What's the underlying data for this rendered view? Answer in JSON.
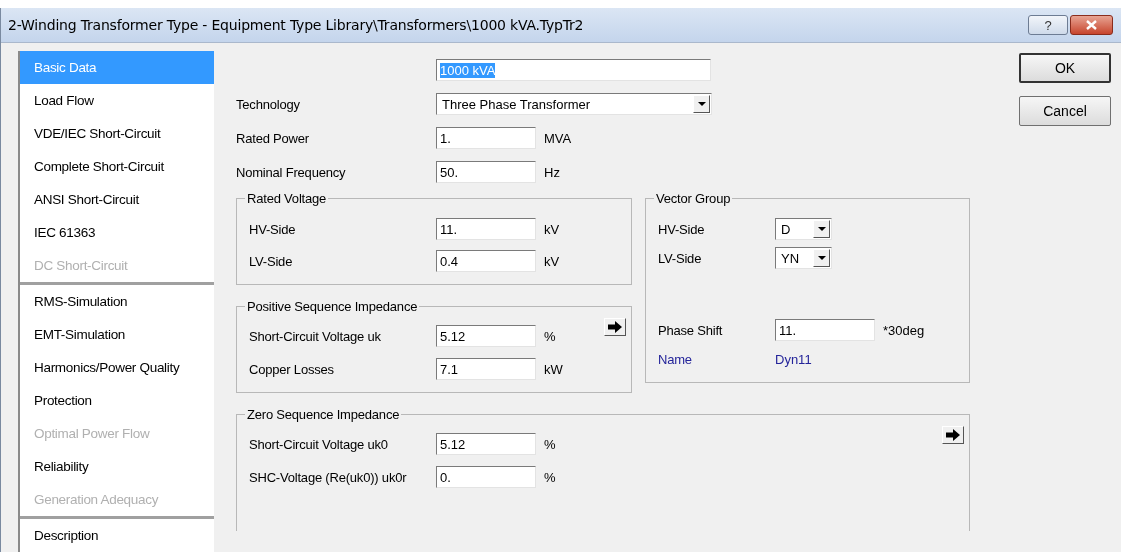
{
  "window": {
    "title": "2-Winding Transformer Type - Equipment Type Library\\Transformers\\1000 kVA.TypTr2",
    "help_button": "?"
  },
  "sidebar": {
    "groups": [
      {
        "items": [
          {
            "label": "Basic Data",
            "selected": true,
            "disabled": false
          },
          {
            "label": "Load Flow",
            "selected": false,
            "disabled": false
          },
          {
            "label": "VDE/IEC Short-Circuit",
            "selected": false,
            "disabled": false
          },
          {
            "label": "Complete Short-Circuit",
            "selected": false,
            "disabled": false
          },
          {
            "label": "ANSI Short-Circuit",
            "selected": false,
            "disabled": false
          },
          {
            "label": "IEC 61363",
            "selected": false,
            "disabled": false
          },
          {
            "label": "DC Short-Circuit",
            "selected": false,
            "disabled": true
          }
        ]
      },
      {
        "items": [
          {
            "label": "RMS-Simulation",
            "selected": false,
            "disabled": false
          },
          {
            "label": "EMT-Simulation",
            "selected": false,
            "disabled": false
          },
          {
            "label": "Harmonics/Power Quality",
            "selected": false,
            "disabled": false
          },
          {
            "label": "Protection",
            "selected": false,
            "disabled": false
          },
          {
            "label": "Optimal Power Flow",
            "selected": false,
            "disabled": true
          },
          {
            "label": "Reliability",
            "selected": false,
            "disabled": false
          },
          {
            "label": "Generation Adequacy",
            "selected": false,
            "disabled": true
          }
        ]
      },
      {
        "items": [
          {
            "label": "Description",
            "selected": false,
            "disabled": false
          }
        ]
      }
    ]
  },
  "form": {
    "name_field": {
      "value": "1000 kVA",
      "text_selected": true
    },
    "technology": {
      "label": "Technology",
      "value": "Three Phase Transformer"
    },
    "fields": [
      {
        "label": "Rated Power",
        "value": "1.",
        "unit": "MVA"
      },
      {
        "label": "Nominal Frequency",
        "value": "50.",
        "unit": "Hz"
      }
    ],
    "rated_voltage": {
      "title": "Rated Voltage",
      "arrow_button": false,
      "fields": [
        {
          "label": "HV-Side",
          "value": "11.",
          "unit": "kV"
        },
        {
          "label": "LV-Side",
          "value": "0.4",
          "unit": "kV"
        }
      ]
    },
    "positive_sequence": {
      "title": "Positive Sequence Impedance",
      "arrow_button": true,
      "fields": [
        {
          "label": "Short-Circuit Voltage uk",
          "value": "5.12",
          "unit": "%"
        },
        {
          "label": "Copper Losses",
          "value": "7.1",
          "unit": "kW"
        }
      ]
    },
    "vector_group": {
      "title": "Vector Group",
      "selects": [
        {
          "label": "HV-Side",
          "value": "D"
        },
        {
          "label": "LV-Side",
          "value": "YN"
        }
      ],
      "phase_shift": {
        "label": "Phase Shift",
        "value": "11.",
        "unit": "*30deg"
      },
      "name": {
        "label": "Name",
        "value": "Dyn11"
      }
    },
    "zero_sequence": {
      "title": "Zero Sequence Impedance",
      "arrow_button": true,
      "fields": [
        {
          "label": "Short-Circuit Voltage uk0",
          "value": "5.12",
          "unit": "%"
        },
        {
          "label": "SHC-Voltage (Re(uk0)) uk0r",
          "value": "0.",
          "unit": "%"
        }
      ]
    }
  },
  "buttons": [
    {
      "label": "OK",
      "default": true
    },
    {
      "label": "Cancel",
      "default": false
    }
  ]
}
